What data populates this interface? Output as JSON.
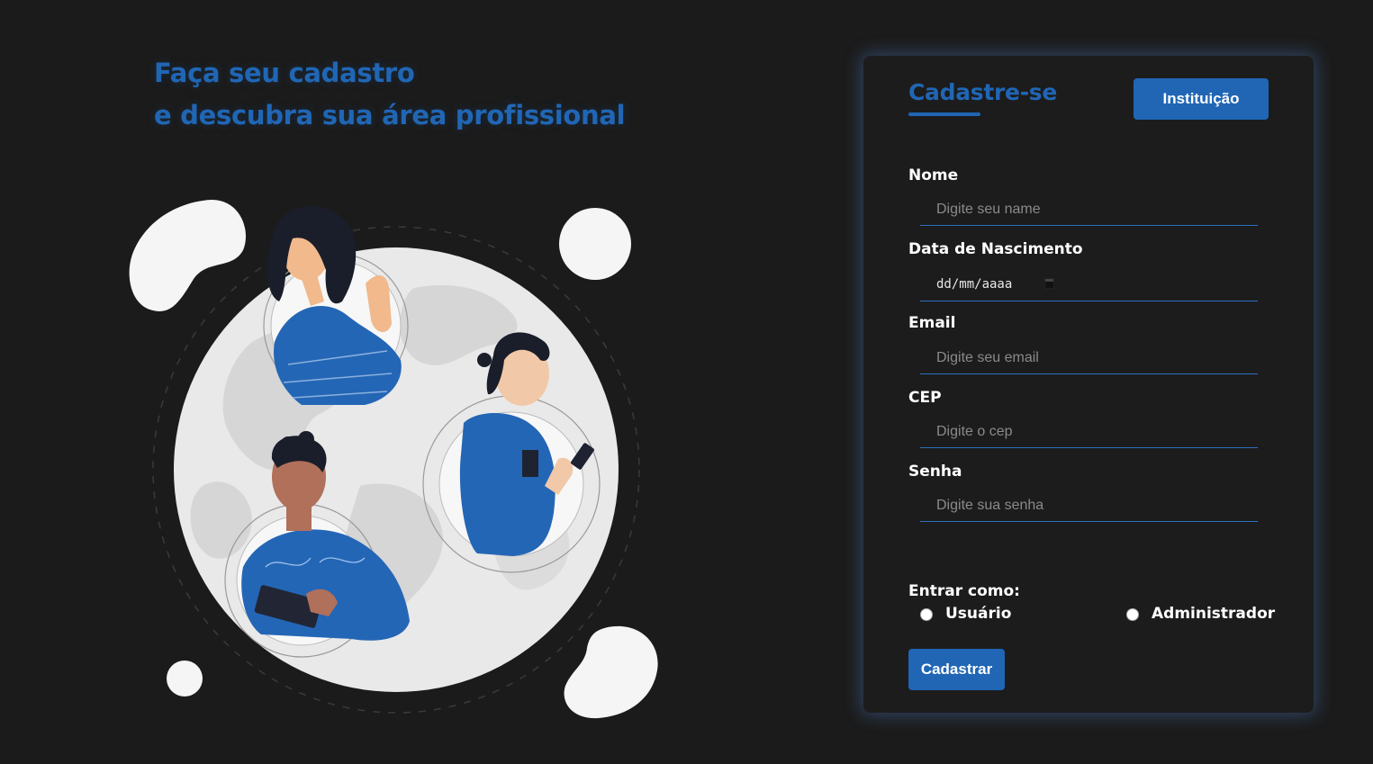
{
  "hero": {
    "line1": "Faça seu cadastro",
    "line2": "e descubra sua área profissional",
    "illustration_icon": "people-globe-illustration"
  },
  "form": {
    "title": "Cadastre-se",
    "institution_button": "Instituição",
    "fields": {
      "name": {
        "label": "Nome",
        "placeholder": "Digite seu name"
      },
      "birthdate": {
        "label": "Data de Nascimento",
        "value": "dd/mm/aaaa",
        "icon": "calendar-icon"
      },
      "email": {
        "label": "Email",
        "placeholder": "Digite seu email"
      },
      "cep": {
        "label": "CEP",
        "placeholder": "Digite o cep"
      },
      "password": {
        "label": "Senha",
        "placeholder": "Digite sua senha"
      }
    },
    "role": {
      "label": "Entrar como:",
      "options": [
        "Usuário",
        "Administrador"
      ]
    },
    "submit": "Cadastrar"
  },
  "colors": {
    "accent": "#2066b5",
    "background": "#1b1b1b",
    "card": "#1c1c1c"
  }
}
